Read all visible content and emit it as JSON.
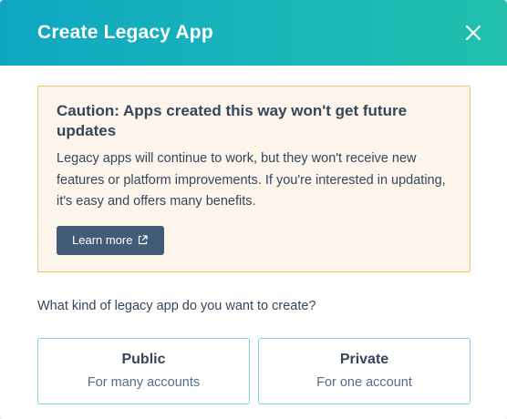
{
  "dialog": {
    "title": "Create Legacy App",
    "close_icon": "close-icon"
  },
  "caution": {
    "title": "Caution: Apps created this way won't get future updates",
    "text": "Legacy apps will continue to work, but they won't receive new features or platform improvements. If you're interested in updating, it's easy and offers many benefits.",
    "learn_more_label": "Learn more",
    "learn_more_icon": "external-link-icon"
  },
  "question": "What kind of legacy app do you want to create?",
  "options": [
    {
      "title": "Public",
      "subtitle": "For many accounts"
    },
    {
      "title": "Private",
      "subtitle": "For one account"
    }
  ],
  "colors": {
    "header_gradient_start": "#0fa6c2",
    "header_gradient_end": "#22c0ad",
    "caution_bg": "#fdf4ec",
    "caution_border": "#f5c26b",
    "button_bg": "#425b76",
    "text": "#33475b",
    "option_border": "#7fd1de"
  }
}
